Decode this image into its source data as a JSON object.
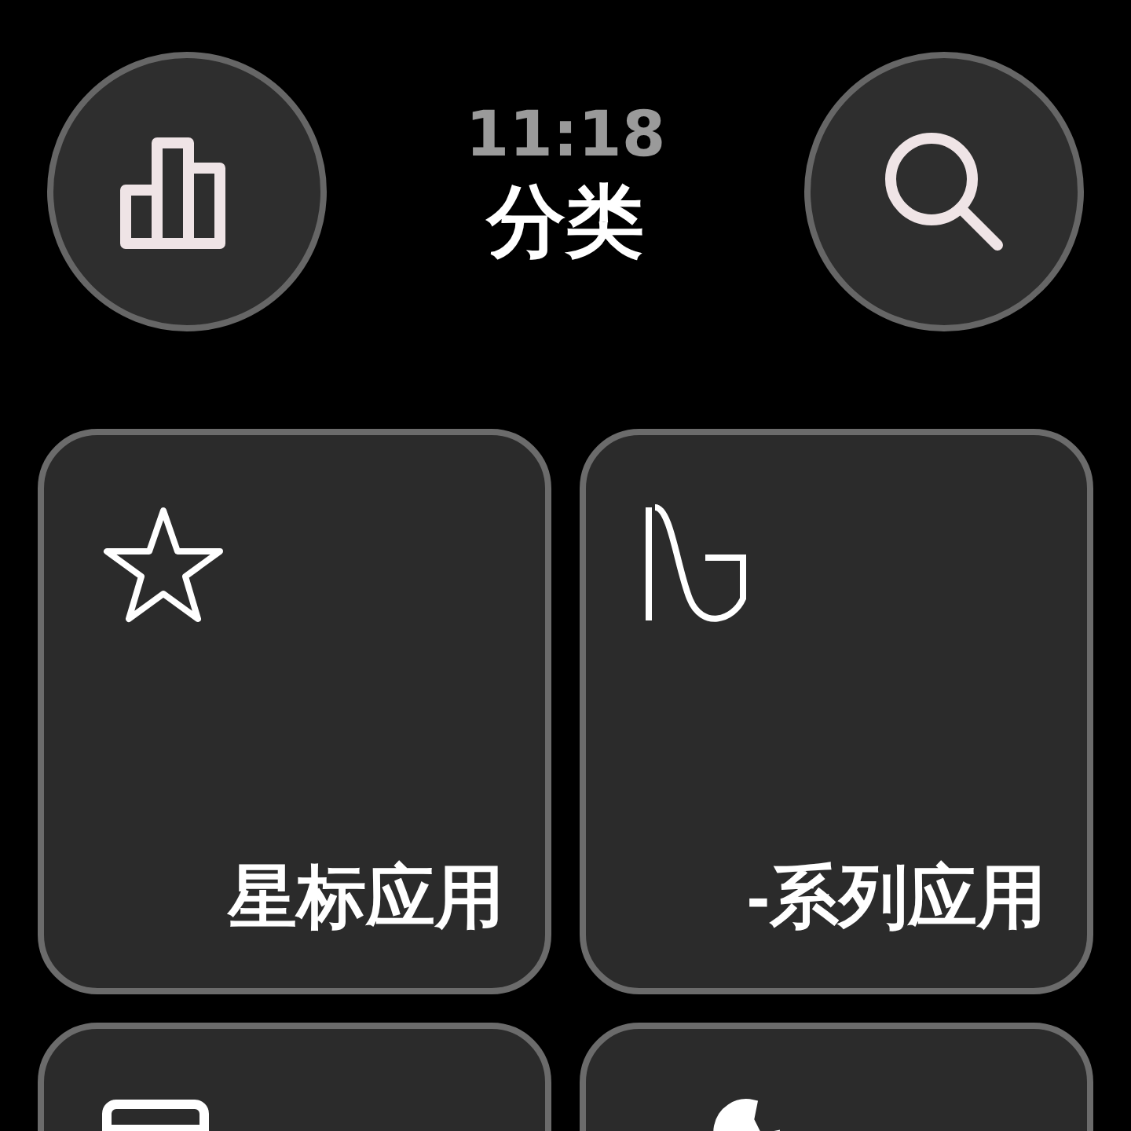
{
  "status": {
    "time": "11:18"
  },
  "title": "分类",
  "header_buttons": [
    {
      "kind": "chart"
    },
    {
      "kind": "search"
    }
  ],
  "categories": [
    {
      "kind": "star",
      "label": "星标应用"
    },
    {
      "kind": "wave",
      "label": "-系列应用"
    },
    {
      "kind": "window"
    },
    {
      "kind": "wrench"
    }
  ]
}
